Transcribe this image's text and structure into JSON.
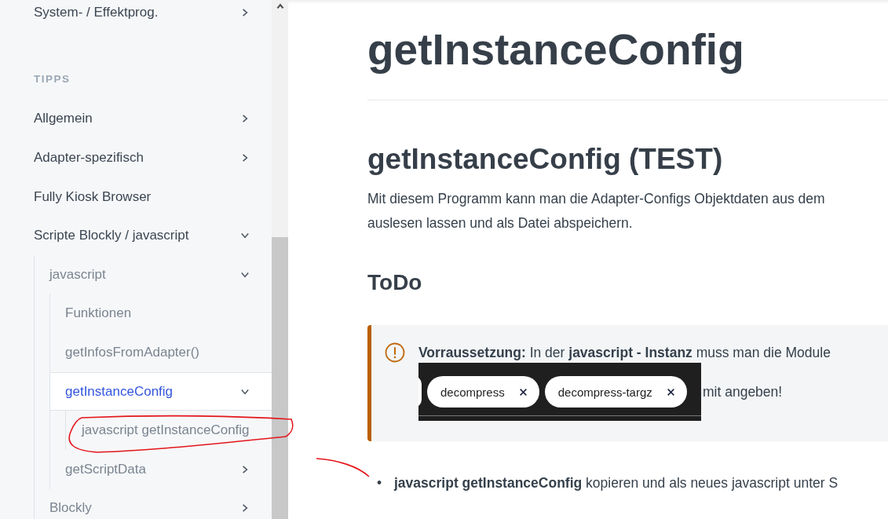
{
  "sidebar": {
    "top_items": [
      {
        "label": "System- / Effektprog.",
        "kind": "folder",
        "expanded": false,
        "selected": false
      }
    ],
    "section": {
      "title": "TIPPS",
      "items": [
        {
          "label": "Allgemein",
          "kind": "folder",
          "expanded": false,
          "selected": false
        },
        {
          "label": "Adapter-spezifisch",
          "kind": "folder",
          "expanded": false,
          "selected": false
        },
        {
          "label": "Fully Kiosk Browser",
          "kind": "page",
          "selected": false
        },
        {
          "label": "Scripte Blockly / javascript",
          "kind": "folder",
          "expanded": true,
          "selected": false,
          "children": [
            {
              "label": "javascript",
              "kind": "folder",
              "expanded": true,
              "selected": false,
              "children": [
                {
                  "label": "Funktionen",
                  "kind": "page",
                  "selected": false
                },
                {
                  "label": "getInfosFromAdapter()",
                  "kind": "page",
                  "selected": false
                },
                {
                  "label": "getInstanceConfig",
                  "kind": "folder",
                  "expanded": true,
                  "selected": true,
                  "children": [
                    {
                      "label": "javascript getInstanceConfig",
                      "selected": false
                    }
                  ]
                },
                {
                  "label": "getScriptData",
                  "kind": "folder",
                  "expanded": false,
                  "selected": false
                }
              ]
            },
            {
              "label": "Blockly",
              "kind": "folder",
              "expanded": false,
              "selected": false
            }
          ]
        }
      ]
    }
  },
  "page": {
    "title": "getInstanceConfig",
    "heading": "getInstanceConfig (TEST)",
    "intro": "Mit diesem Programm kann man die Adapter-Configs Objektdaten aus dem\nauslesen lassen und als Datei abspeichern.",
    "subheading": "ToDo",
    "callout": {
      "text": "**Vorraussetzung:** In der **javascript - Instanz** muss man die Module",
      "chips": [
        {
          "label": "decompress"
        },
        {
          "label": "decompress-targz"
        }
      ],
      "text_after": "mit angeben!"
    },
    "bullets": [
      {
        "marker": "•",
        "text": "**javascript getInstanceConfig** kopieren und als neues javascript unter S"
      }
    ]
  }
}
